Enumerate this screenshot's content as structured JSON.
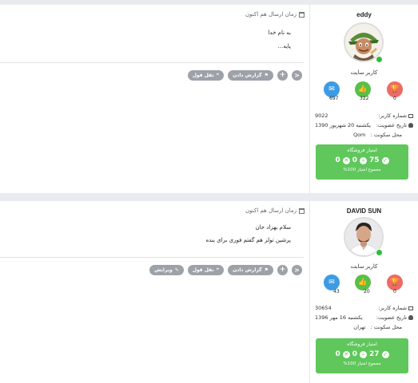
{
  "posts": [
    {
      "time_label": "زمان ارسال هم اکنون",
      "body_lines": [
        "به نام خدا",
        "پایه..."
      ],
      "actions": {
        "quote": "نقل قول",
        "report": "گزارش دادن",
        "add": "+",
        "share": "<"
      },
      "author": {
        "username": "eddy",
        "role": "کاربر سایت",
        "stats": {
          "comments": "697",
          "likes": "322",
          "trophies": "0"
        },
        "user_number_label": "شماره کاربر:",
        "user_number": "9022",
        "join_label": "تاریخ عضویت:",
        "join_date": "یکشنبه 20 شهریور 1390",
        "location_label": "محل سکونت :",
        "location": "Qom",
        "shop": {
          "title": "امتیاز فروشگاه",
          "positive": "75",
          "neutral": "0",
          "negative": "0",
          "total": "مجموع امتیاز 100%"
        }
      }
    },
    {
      "time_label": "زمان ارسال هم اکنون",
      "body_lines": [
        "سلام بهزاد خان",
        "پرشین تولز هم گفتم فوری برای بنده"
      ],
      "actions": {
        "edit": "ویرایش",
        "quote": "نقل قول",
        "report": "گزارش دادن",
        "add": "+",
        "share": "<"
      },
      "author": {
        "username": "DAVID SUN",
        "role": "کاربر سایت",
        "stats": {
          "comments": "43",
          "likes": "20",
          "trophies": "0"
        },
        "user_number_label": "شماره کاربر:",
        "user_number": "30654",
        "join_label": "تاریخ عضویت:",
        "join_date": "یکشنبه 16 مهر 1396",
        "location_label": "محل سکونت :",
        "location": "تهران",
        "shop": {
          "title": "امتیاز فروشگاه",
          "positive": "27",
          "neutral": "0",
          "negative": "0",
          "total": "مجموع امتیاز 100%"
        }
      }
    }
  ],
  "colors": {
    "accent_green": "#5fc75b",
    "blue": "#3d9be5",
    "red": "#ee6a64",
    "online": "#2ebd3a",
    "button_gray": "#9da2a8"
  },
  "icons": {
    "calendar": "calendar-icon",
    "comments": "comments-icon",
    "likes": "thumbs-up-icon",
    "trophies": "trophy-icon",
    "quote": "quote-icon",
    "report": "flag-icon",
    "edit": "edit-icon",
    "share": "share-icon",
    "add": "plus-icon"
  }
}
